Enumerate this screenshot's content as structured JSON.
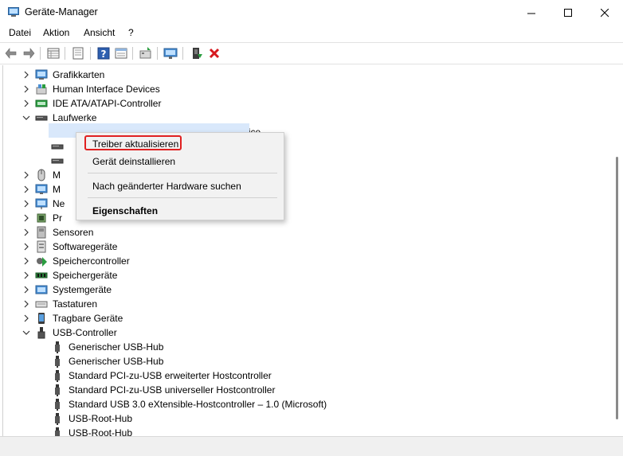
{
  "window": {
    "title": "Geräte-Manager"
  },
  "menu": [
    {
      "label": "Datei"
    },
    {
      "label": "Aktion"
    },
    {
      "label": "Ansicht"
    },
    {
      "label": "?"
    }
  ],
  "toolbar_icons": [
    "back-icon",
    "forward-icon",
    "properties-grid-icon",
    "properties-sheet-icon",
    "help-icon",
    "driver-details-icon",
    "update-driver-icon",
    "monitor-scan-icon",
    "add-device-icon",
    "uninstall-icon"
  ],
  "tree": {
    "rows": [
      {
        "label": "Grafikkarten",
        "icon": "display-adapter-icon",
        "expanded": false
      },
      {
        "label": "Human Interface Devices",
        "icon": "hid-icon",
        "expanded": false
      },
      {
        "label": "IDE ATA/ATAPI-Controller",
        "icon": "ide-controller-icon",
        "expanded": false
      },
      {
        "label": "Laufwerke",
        "icon": "disk-drive-icon",
        "expanded": true
      },
      {
        "label": "VMware, VMware Virtual S SCSI Disk Device",
        "icon": "disk-drive-icon",
        "child": true
      },
      {
        "label": "",
        "icon": "disk-drive-icon",
        "child": true
      },
      {
        "label": "",
        "icon": "disk-drive-icon",
        "child": true
      },
      {
        "label": "M",
        "icon": "mouse-icon",
        "expanded": false
      },
      {
        "label": "M",
        "icon": "monitor-icon",
        "expanded": false
      },
      {
        "label": "Ne",
        "icon": "network-adapter-icon",
        "expanded": false
      },
      {
        "label": "Pr",
        "icon": "processor-icon",
        "expanded": false
      },
      {
        "label": "Sensoren",
        "icon": "sensor-icon",
        "expanded": false
      },
      {
        "label": "Softwaregeräte",
        "icon": "software-device-icon",
        "expanded": false
      },
      {
        "label": "Speichercontroller",
        "icon": "storage-controller-icon",
        "expanded": false
      },
      {
        "label": "Speichergeräte",
        "icon": "memory-icon",
        "expanded": false
      },
      {
        "label": "Systemgeräte",
        "icon": "system-device-icon",
        "expanded": false
      },
      {
        "label": "Tastaturen",
        "icon": "keyboard-icon",
        "expanded": false
      },
      {
        "label": "Tragbare Geräte",
        "icon": "portable-device-icon",
        "expanded": false
      },
      {
        "label": "USB-Controller",
        "icon": "usb-icon",
        "expanded": true
      },
      {
        "label": "Generischer USB-Hub",
        "icon": "usb-plug-icon",
        "child": true
      },
      {
        "label": "Generischer USB-Hub",
        "icon": "usb-plug-icon",
        "child": true
      },
      {
        "label": "Standard PCI-zu-USB erweiterter Hostcontroller",
        "icon": "usb-plug-icon",
        "child": true
      },
      {
        "label": "Standard PCI-zu-USB universeller Hostcontroller",
        "icon": "usb-plug-icon",
        "child": true
      },
      {
        "label": "Standard USB 3.0 eXtensible-Hostcontroller – 1.0 (Microsoft)",
        "icon": "usb-plug-icon",
        "child": true
      },
      {
        "label": "USB-Root-Hub",
        "icon": "usb-plug-icon",
        "child": true
      },
      {
        "label": "USB-Root-Hub",
        "icon": "usb-plug-icon",
        "child": true
      }
    ]
  },
  "context_menu": {
    "items": [
      {
        "label": "Treiber aktualisieren",
        "highlighted": true
      },
      {
        "label": "Gerät deinstallieren"
      },
      {
        "label": "Nach geänderter Hardware suchen"
      },
      {
        "label": "Eigenschaften",
        "bold": true
      }
    ],
    "highlight_color": "#e02020"
  }
}
